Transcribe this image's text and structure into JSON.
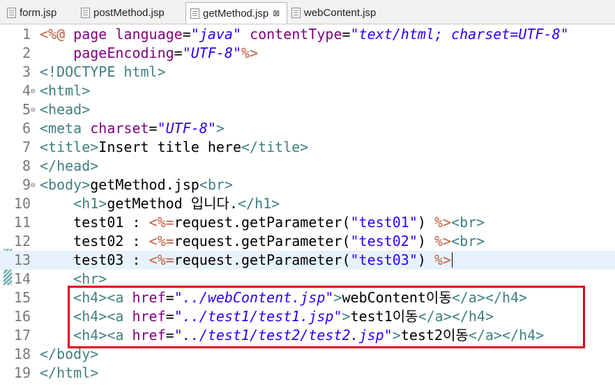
{
  "tabs": [
    {
      "label": "form.jsp"
    },
    {
      "label": "postMethod.jsp"
    },
    {
      "label": "getMethod.jsp",
      "close": "⊠"
    },
    {
      "label": "webContent.jsp"
    }
  ],
  "lines": [
    {
      "n": "1",
      "fold": "",
      "c": [
        "<%@ ",
        "page ",
        "language",
        "=",
        "\"java\"",
        " ",
        "contentType",
        "=",
        "\"text/html; charset=UTF-8\""
      ]
    },
    {
      "n": "2",
      "fold": "",
      "c": [
        "    ",
        "pageEncoding",
        "=",
        "\"UTF-8\"",
        "%>"
      ]
    },
    {
      "n": "3",
      "fold": "",
      "c": [
        "<!DOCTYPE html>"
      ]
    },
    {
      "n": "4",
      "fold": "⊖",
      "c": [
        "<html>"
      ]
    },
    {
      "n": "5",
      "fold": "⊖",
      "c": [
        "<head>"
      ]
    },
    {
      "n": "6",
      "fold": "",
      "c": [
        "<meta ",
        "charset",
        "=",
        "\"UTF-8\"",
        ">"
      ]
    },
    {
      "n": "7",
      "fold": "",
      "c": [
        "<title>",
        "Insert title here",
        "</title>"
      ]
    },
    {
      "n": "8",
      "fold": "",
      "c": [
        "</head>"
      ]
    },
    {
      "n": "9",
      "fold": "⊖",
      "c": [
        "<body>",
        "getMethod.jsp",
        "<br>"
      ]
    },
    {
      "n": "10",
      "fold": "",
      "c": [
        "    ",
        "<h1>",
        "getMethod 입니다.",
        "</h1>"
      ]
    },
    {
      "n": "11",
      "fold": "",
      "c": [
        "    ",
        "test01 : ",
        "<%=",
        "request.getParameter(",
        "\"test01\"",
        ") ",
        "%>",
        "<br>"
      ]
    },
    {
      "n": "12",
      "fold": "",
      "c": [
        "    ",
        "test02 : ",
        "<%=",
        "request.getParameter(",
        "\"test02\"",
        ") ",
        "%>",
        "<br>"
      ]
    },
    {
      "n": "13",
      "fold": "",
      "c": [
        "    ",
        "test03 : ",
        "<%=",
        "request.getParameter(",
        "\"test03\"",
        ") ",
        "%>"
      ]
    },
    {
      "n": "14",
      "fold": "",
      "c": [
        "    ",
        "<hr>"
      ]
    },
    {
      "n": "15",
      "fold": "",
      "c": [
        "    ",
        "<h4><a ",
        "href",
        "=",
        "\"../webContent.jsp\"",
        ">",
        "webContent이동",
        "</a></h4>"
      ]
    },
    {
      "n": "16",
      "fold": "",
      "c": [
        "    ",
        "<h4><a ",
        "href",
        "=",
        "\"../test1/test1.jsp\"",
        ">",
        "test1이동",
        "</a></h4>"
      ]
    },
    {
      "n": "17",
      "fold": "",
      "c": [
        "    ",
        "<h4><a ",
        "href",
        "=",
        "\"../test1/test2/test2.jsp\"",
        ">",
        "test2이동",
        "</a></h4>"
      ]
    },
    {
      "n": "18",
      "fold": "",
      "c": [
        "</body>"
      ]
    },
    {
      "n": "19",
      "fold": "",
      "c": [
        "</html>"
      ]
    }
  ],
  "colors": {
    "tag": "#3f7f7f",
    "attr": "#7f007f",
    "string": "#2a00ff",
    "jsp": "#bf5f3f",
    "highlight_box": "#e0001a"
  }
}
